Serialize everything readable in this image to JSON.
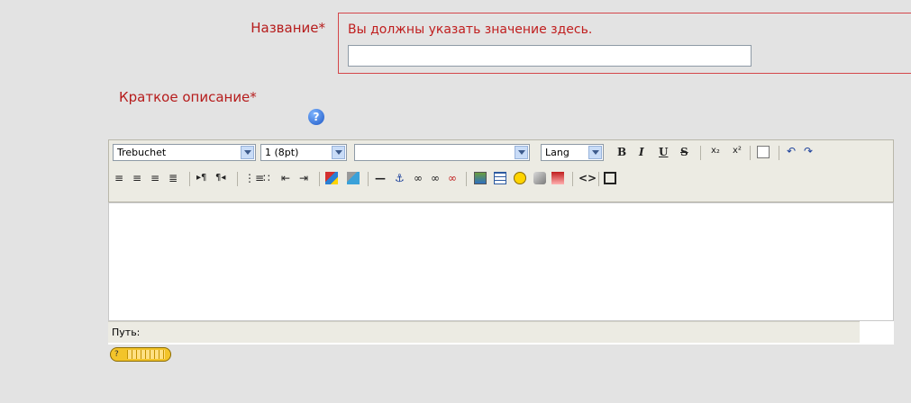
{
  "form": {
    "name_label": "Название",
    "required_mark": "*",
    "error_message": "Вы должны указать значение здесь.",
    "name_value": "",
    "description_label": "Краткое описание",
    "help_icon": "help-icon"
  },
  "editor": {
    "font_family": "Trebuchet",
    "font_size": "1 (8pt)",
    "format_value": "",
    "lang": "Lang",
    "toolbar_icons": [
      "bold-icon",
      "italic-icon",
      "underline-icon",
      "strikethrough-icon",
      "subscript-icon",
      "superscript-icon",
      "clean-word-icon",
      "undo-icon",
      "redo-icon",
      "align-left-icon",
      "align-center-icon",
      "align-right-icon",
      "justify-icon",
      "ltr-icon",
      "rtl-icon",
      "ordered-list-icon",
      "unordered-list-icon",
      "outdent-icon",
      "indent-icon",
      "text-color-icon",
      "highlight-icon",
      "horizontal-rule-icon",
      "anchor-icon",
      "link-icon",
      "unlink-icon",
      "nolink-icon",
      "image-icon",
      "table-icon",
      "smiley-icon",
      "special-char-icon",
      "search-replace-icon",
      "html-source-icon",
      "fullscreen-icon"
    ],
    "path_label": "Путь:",
    "keyboard_button": "?"
  },
  "colors": {
    "error": "#c01e1e",
    "toolbar_bg": "#ecebe3",
    "page_bg": "#e3e3e3"
  }
}
